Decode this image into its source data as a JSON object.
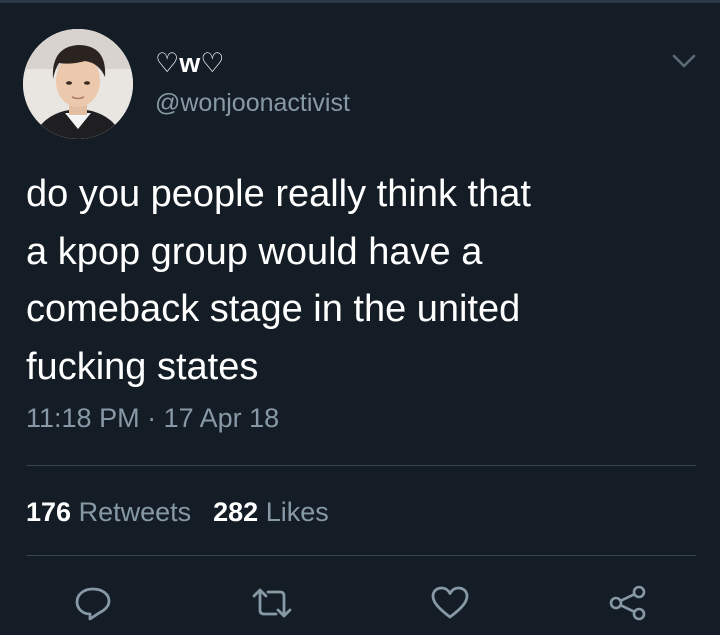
{
  "tweet": {
    "display_name": "♡w♡",
    "handle": "@wonjoonactivist",
    "text_lines": [
      "do you people really think that",
      "a kpop group would have a",
      "comeback stage in the united",
      "fucking states"
    ],
    "time": "11:18 PM",
    "separator": "·",
    "date": "17 Apr 18"
  },
  "stats": {
    "retweets_count": "176",
    "retweets_label": "Retweets",
    "likes_count": "282",
    "likes_label": "Likes"
  },
  "icons": {
    "menu": "chevron-down-icon",
    "reply": "reply-icon",
    "retweet": "retweet-icon",
    "like": "heart-icon",
    "share": "share-icon"
  },
  "colors": {
    "background": "#141d26",
    "text": "#ffffff",
    "secondary": "#8899a6",
    "divider": "#38444d"
  }
}
